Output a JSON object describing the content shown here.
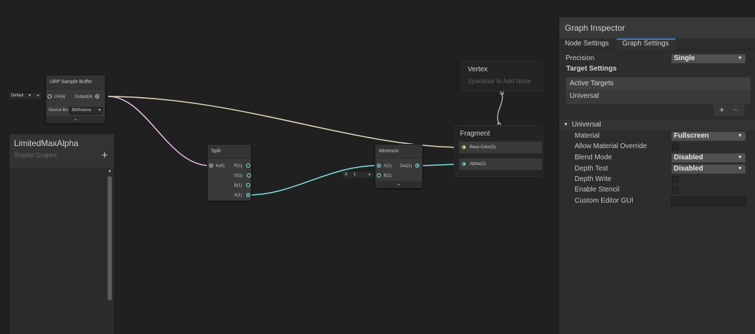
{
  "blackboard": {
    "title": "LimitedMaxAlpha",
    "subtitle": "Shader Graphs",
    "add_label": "+"
  },
  "nodes": {
    "urp_sample_buffer": {
      "title": "URP Sample Buffer",
      "input_uv": "UV(4)",
      "output": "Output(4)",
      "uv_field": "Defaul",
      "source_label": "Source Bu",
      "source_value": "BlitSource"
    },
    "split": {
      "title": "Split",
      "input": "In(4)",
      "outputs": [
        "R(1)",
        "G(1)",
        "B(1)",
        "A(1)"
      ]
    },
    "minimum": {
      "title": "Minimum",
      "input_a": "A(1)",
      "input_b": "B(1)",
      "output": "Out(1)",
      "b_axis": "X",
      "b_value": "1"
    }
  },
  "master_stack": {
    "vertex": {
      "title": "Vertex",
      "hint": "Spacebar to Add Node"
    },
    "fragment": {
      "title": "Fragment",
      "blocks": [
        "Base Color(3)",
        "Alpha(1)"
      ]
    }
  },
  "inspector": {
    "title": "Graph Inspector",
    "tabs": [
      "Node Settings",
      "Graph Settings"
    ],
    "active_tab": "Graph Settings",
    "precision_label": "Precision",
    "precision_value": "Single",
    "target_settings_label": "Target Settings",
    "active_targets_label": "Active Targets",
    "active_targets": [
      "Universal"
    ],
    "add_button": "+",
    "remove_button": "−",
    "universal_section": "Universal",
    "properties": [
      {
        "label": "Material",
        "type": "dropdown",
        "value": "Fullscreen"
      },
      {
        "label": "Allow Material Override",
        "type": "toggle",
        "value": false
      },
      {
        "label": "Blend Mode",
        "type": "dropdown",
        "value": "Disabled"
      },
      {
        "label": "Depth Test",
        "type": "dropdown",
        "value": "Disabled"
      },
      {
        "label": "Depth Write",
        "type": "toggle",
        "value": false
      },
      {
        "label": "Enable Stencil",
        "type": "toggle",
        "value": false
      },
      {
        "label": "Custom Editor GUI",
        "type": "text",
        "value": ""
      }
    ]
  },
  "colors": {
    "background": "#202020",
    "wire_vector4": "#f1c0f1",
    "wire_vector3": "#f6ff9a",
    "wire_float": "#84e4e7",
    "tab_accent": "#3d7bd0"
  }
}
